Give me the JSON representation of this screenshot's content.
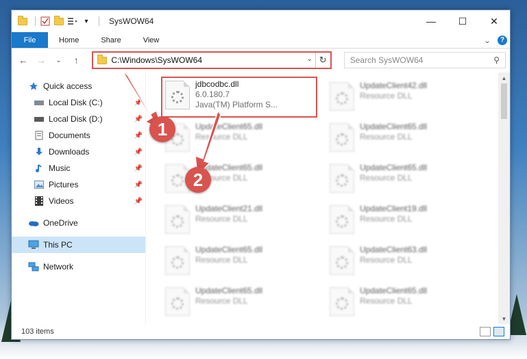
{
  "window": {
    "title": "SysWOW64",
    "controls": {
      "minimize": "—",
      "maximize": "☐",
      "close": "✕"
    }
  },
  "ribbon": {
    "tabs": [
      "File",
      "Home",
      "Share",
      "View"
    ],
    "collapse_glyph": "⌄",
    "help_glyph": "?"
  },
  "address": {
    "path": "C:\\Windows\\SysWOW64",
    "dropdown_glyph": "⌄",
    "refresh_glyph": "↻"
  },
  "search": {
    "placeholder": "Search SysWOW64",
    "icon_glyph": "⚲"
  },
  "nav": {
    "back": "←",
    "forward": "→",
    "recent": "⌄",
    "up": "↑"
  },
  "sidebar": {
    "quick_access": "Quick access",
    "items": [
      {
        "label": "Local Disk (C:)",
        "icon": "drive-icon"
      },
      {
        "label": "Local Disk (D:)",
        "icon": "drive-icon"
      },
      {
        "label": "Documents",
        "icon": "documents-icon"
      },
      {
        "label": "Downloads",
        "icon": "downloads-icon"
      },
      {
        "label": "Music",
        "icon": "music-icon"
      },
      {
        "label": "Pictures",
        "icon": "pictures-icon"
      },
      {
        "label": "Videos",
        "icon": "videos-icon"
      }
    ],
    "onedrive": "OneDrive",
    "this_pc": "This PC",
    "network": "Network",
    "pin_glyph": "📌"
  },
  "files": [
    {
      "name": "jdbcodbc.dll",
      "line1": "6.0.180.7",
      "line2": "Java(TM) Platform S...",
      "highlighted": true
    },
    {
      "name": "UpdateClient42.dll",
      "line1": "Resource DLL"
    },
    {
      "name": "UpdateClient65.dll",
      "line1": "Resource DLL"
    },
    {
      "name": "UpdateClient65.dll",
      "line1": "Resource DLL"
    },
    {
      "name": "UpdateClient65.dll",
      "line1": "Resource DLL"
    },
    {
      "name": "UpdateClient65.dll",
      "line1": "Resource DLL"
    },
    {
      "name": "UpdateClient21.dll",
      "line1": "Resource DLL"
    },
    {
      "name": "UpdateClient19.dll",
      "line1": "Resource DLL"
    },
    {
      "name": "UpdateClient65.dll",
      "line1": "Resource DLL"
    },
    {
      "name": "UpdateClient63.dll",
      "line1": "Resource DLL"
    },
    {
      "name": "UpdateClient65.dll",
      "line1": "Resource DLL"
    },
    {
      "name": "UpdateClient65.dll",
      "line1": "Resource DLL"
    }
  ],
  "status": {
    "count": "103 items"
  },
  "callouts": {
    "one": "1",
    "two": "2"
  },
  "colors": {
    "accent": "#1979ca",
    "callout": "#d9534f",
    "selected": "#cce4f7"
  }
}
